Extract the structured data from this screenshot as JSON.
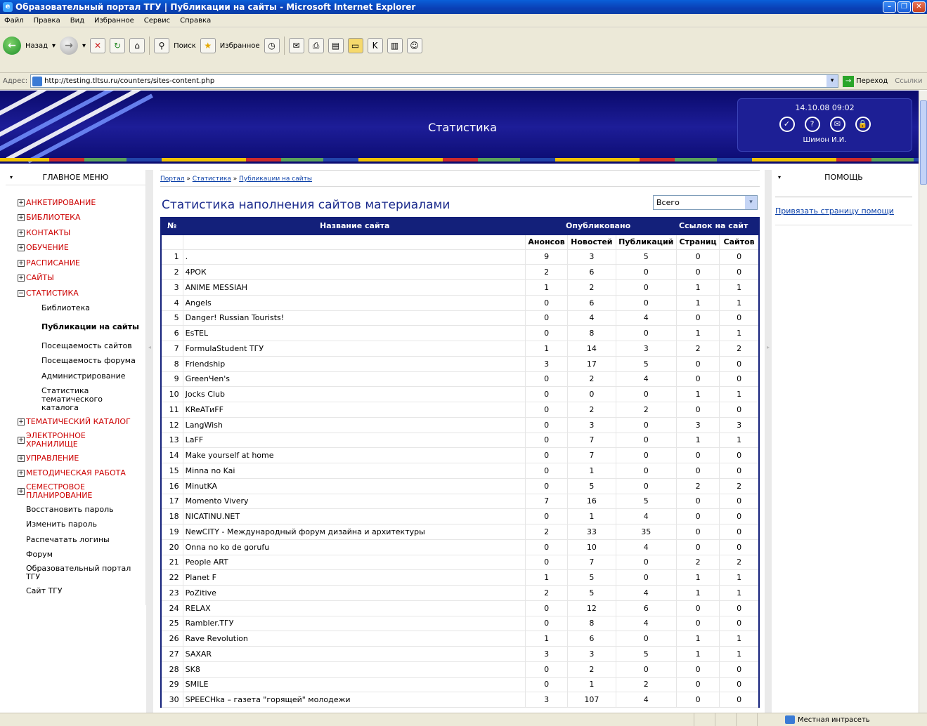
{
  "window": {
    "title": "Образовательный портал ТГУ | Публикации на сайты - Microsoft Internet Explorer"
  },
  "menubar": [
    "Файл",
    "Правка",
    "Вид",
    "Избранное",
    "Сервис",
    "Справка"
  ],
  "toolbar": {
    "back": "Назад",
    "search": "Поиск",
    "favorites": "Избранное"
  },
  "addressbar": {
    "label": "Адрес:",
    "url": "http://testing.tltsu.ru/counters/sites-content.php",
    "go": "Переход",
    "links": "Ссылки"
  },
  "header": {
    "title": "Статистика",
    "datetime": "14.10.08 09:02",
    "user": "Шимон И.И."
  },
  "leftmenu": {
    "title": "ГЛАВНОЕ МЕНЮ",
    "sections_top": [
      "АНКЕТИРОВАНИЕ",
      "БИБЛИОТЕКА",
      "КОНТАКТЫ",
      "ОБУЧЕНИЕ",
      "РАСПИСАНИЕ",
      "САЙТЫ"
    ],
    "stat_section": "СТАТИСТИКА",
    "stat_items": [
      "Библиотека",
      "Публикации на сайты",
      "Посещаемость сайтов",
      "Посещаемость форума",
      "Администрирование",
      "Статистика тематического каталога"
    ],
    "sections_bottom": [
      "ТЕМАТИЧЕСКИЙ КАТАЛОГ",
      "ЭЛЕКТРОННОЕ ХРАНИЛИЩЕ",
      "УПРАВЛЕНИЕ",
      "МЕТОДИЧЕСКАЯ РАБОТА",
      "СЕМЕСТРОВОЕ ПЛАНИРОВАНИЕ"
    ],
    "links": [
      "Восстановить пароль",
      "Изменить пароль",
      "Распечатать логины",
      "Форум",
      "Образовательный портал ТГУ",
      "Сайт ТГУ"
    ]
  },
  "breadcrumb": {
    "portal": "Портал",
    "sep": "»",
    "stats": "Статистика",
    "current": "Публикации на сайты"
  },
  "page": {
    "title": "Статистика наполнения сайтов материалами",
    "filter": "Всего"
  },
  "table": {
    "h_num": "№",
    "h_name": "Название сайта",
    "h_published": "Опубликовано",
    "h_links": "Ссылок на сайт",
    "sub": [
      "Анонсов",
      "Новостей",
      "Публикаций",
      "Страниц",
      "Сайтов"
    ],
    "rows": [
      [
        "1",
        ".",
        "9",
        "3",
        "5",
        "0",
        "0"
      ],
      [
        "2",
        "4PОК",
        "2",
        "6",
        "0",
        "0",
        "0"
      ],
      [
        "3",
        "ANIME MESSIAH",
        "1",
        "2",
        "0",
        "1",
        "1"
      ],
      [
        "4",
        "Angels",
        "0",
        "6",
        "0",
        "1",
        "1"
      ],
      [
        "5",
        "Danger! Russian Tourists!",
        "0",
        "4",
        "4",
        "0",
        "0"
      ],
      [
        "6",
        "EsTEL",
        "0",
        "8",
        "0",
        "1",
        "1"
      ],
      [
        "7",
        "FormulaStudent ТГУ",
        "1",
        "14",
        "3",
        "2",
        "2"
      ],
      [
        "8",
        "Friendship",
        "3",
        "17",
        "5",
        "0",
        "0"
      ],
      [
        "9",
        "GreenЧеn's",
        "0",
        "2",
        "4",
        "0",
        "0"
      ],
      [
        "10",
        "Jocks Club",
        "0",
        "0",
        "0",
        "1",
        "1"
      ],
      [
        "11",
        "KReATиFF",
        "0",
        "2",
        "2",
        "0",
        "0"
      ],
      [
        "12",
        "LangWish",
        "0",
        "3",
        "0",
        "3",
        "3"
      ],
      [
        "13",
        "LaFF",
        "0",
        "7",
        "0",
        "1",
        "1"
      ],
      [
        "14",
        "Make yourself at home",
        "0",
        "7",
        "0",
        "0",
        "0"
      ],
      [
        "15",
        "Minna no Kai",
        "0",
        "1",
        "0",
        "0",
        "0"
      ],
      [
        "16",
        "MinutKA",
        "0",
        "5",
        "0",
        "2",
        "2"
      ],
      [
        "17",
        "Momento Vivery",
        "7",
        "16",
        "5",
        "0",
        "0"
      ],
      [
        "18",
        "NICATINU.NET",
        "0",
        "1",
        "4",
        "0",
        "0"
      ],
      [
        "19",
        "NewCITY - Международный форум дизайна и архитектуры",
        "2",
        "33",
        "35",
        "0",
        "0"
      ],
      [
        "20",
        "Onna no ko de gorufu",
        "0",
        "10",
        "4",
        "0",
        "0"
      ],
      [
        "21",
        "People ART",
        "0",
        "7",
        "0",
        "2",
        "2"
      ],
      [
        "22",
        "Planet F",
        "1",
        "5",
        "0",
        "1",
        "1"
      ],
      [
        "23",
        "PoZitive",
        "2",
        "5",
        "4",
        "1",
        "1"
      ],
      [
        "24",
        "RELAX",
        "0",
        "12",
        "6",
        "0",
        "0"
      ],
      [
        "25",
        "Rambler.ТГУ",
        "0",
        "8",
        "4",
        "0",
        "0"
      ],
      [
        "26",
        "Rave Revolution",
        "1",
        "6",
        "0",
        "1",
        "1"
      ],
      [
        "27",
        "SAXAR",
        "3",
        "3",
        "5",
        "1",
        "1"
      ],
      [
        "28",
        "SK8",
        "0",
        "2",
        "0",
        "0",
        "0"
      ],
      [
        "29",
        "SMILE",
        "0",
        "1",
        "2",
        "0",
        "0"
      ],
      [
        "30",
        "SPEECHka – газета \"горящей\" молодежи",
        "3",
        "107",
        "4",
        "0",
        "0"
      ]
    ]
  },
  "rightcol": {
    "title": "ПОМОЩЬ",
    "link": "Привязать страницу помощи"
  },
  "statusbar": {
    "zone": "Местная интрасеть"
  }
}
